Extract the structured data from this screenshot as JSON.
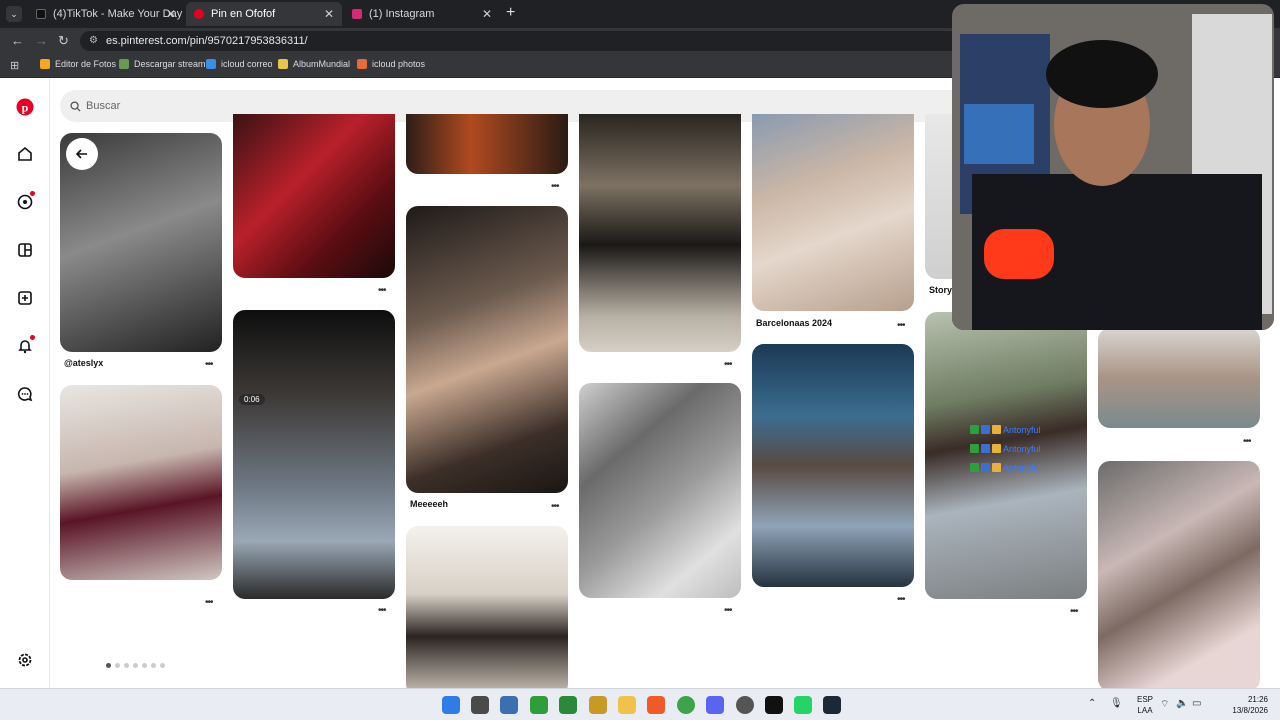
{
  "browser": {
    "tabs": [
      {
        "label": "(4)TikTok - Make Your Day",
        "color": "#111111"
      },
      {
        "label": "Pin en Ofofof",
        "color": "#e60023"
      },
      {
        "label": "(1) Instagram",
        "color": "#d62976"
      }
    ],
    "url": "es.pinterest.com/pin/9570217953836311/",
    "bookmarks": [
      {
        "label": "Editor de Fotos",
        "color": "#f5a623"
      },
      {
        "label": "Descargar stream",
        "color": "#6a9955"
      },
      {
        "label": "icloud correo",
        "color": "#3a8ee6"
      },
      {
        "label": "AlbumMundial",
        "color": "#e8c547"
      },
      {
        "label": "icloud photos",
        "color": "#e86a3a"
      }
    ]
  },
  "search": {
    "placeholder": "Buscar"
  },
  "sidebar": {
    "icons": [
      "pinterest-logo-icon",
      "home-icon",
      "explore-icon",
      "boards-icon",
      "create-icon",
      "notifications-icon",
      "messages-icon",
      "settings-icon"
    ]
  },
  "pins": {
    "captions": [
      "@ateslyx",
      "Meeeeeh",
      "Barcelonaas 2024",
      "Story"
    ],
    "video_badge": "0:06"
  },
  "overlay": {
    "names": [
      "Antonyful",
      "Antonyful",
      "Antonyful"
    ]
  },
  "taskbar": {
    "lang_top": "ESP",
    "lang_bottom": "LAA",
    "time": "21:26",
    "date": "13/8/2026"
  },
  "colors": {
    "accent": "#e60023"
  }
}
